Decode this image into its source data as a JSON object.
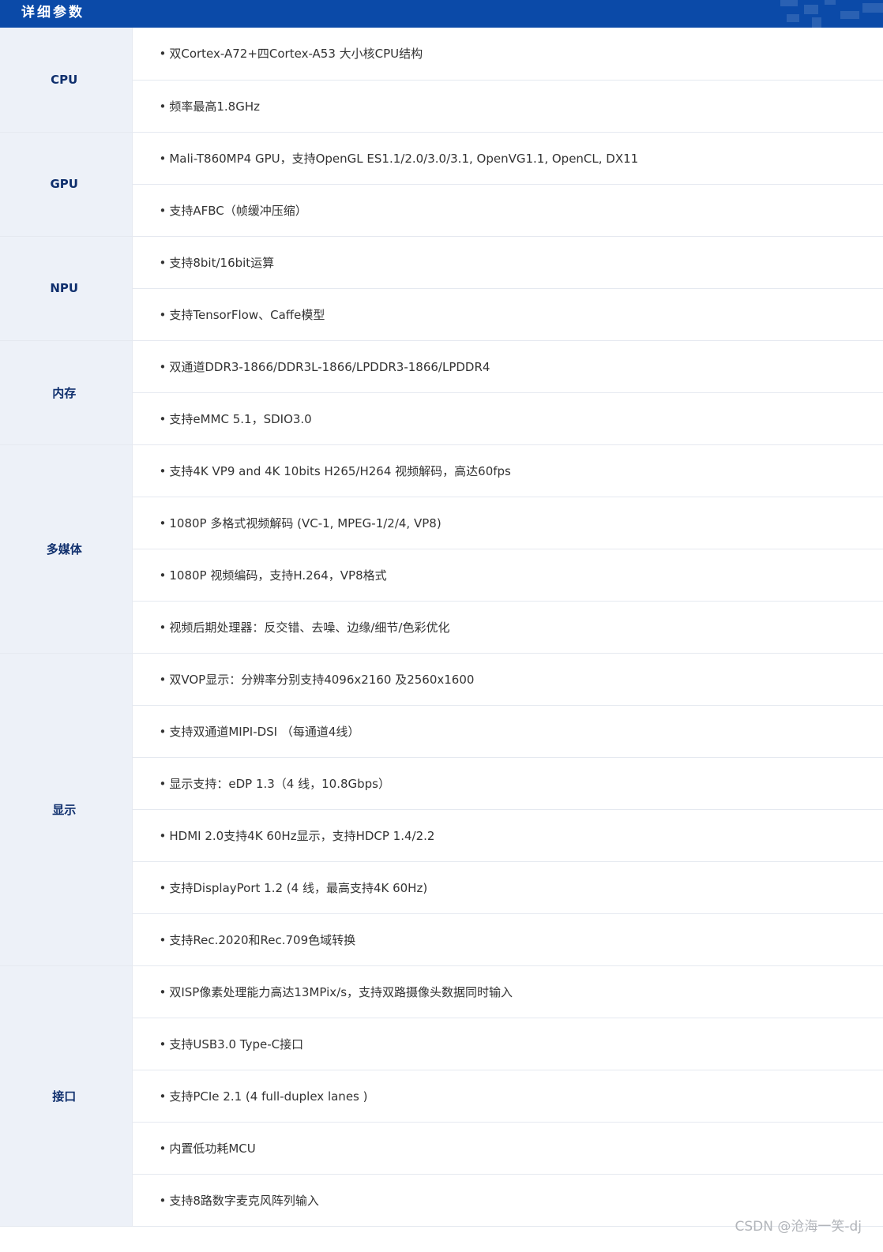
{
  "header": {
    "title": "详细参数"
  },
  "groups": [
    {
      "label": "CPU",
      "items": [
        "双Cortex-A72+四Cortex-A53 大小核CPU结构",
        "频率最高1.8GHz"
      ]
    },
    {
      "label": "GPU",
      "items": [
        "Mali-T860MP4 GPU，支持OpenGL ES1.1/2.0/3.0/3.1, OpenVG1.1, OpenCL, DX11",
        "支持AFBC（帧缓冲压缩）"
      ]
    },
    {
      "label": "NPU",
      "items": [
        "支持8bit/16bit运算",
        "支持TensorFlow、Caffe模型"
      ]
    },
    {
      "label": "内存",
      "items": [
        "双通道DDR3-1866/DDR3L-1866/LPDDR3-1866/LPDDR4",
        "支持eMMC 5.1，SDIO3.0"
      ]
    },
    {
      "label": "多媒体",
      "items": [
        "支持4K VP9 and 4K 10bits H265/H264 视频解码，高达60fps",
        "1080P 多格式视频解码 (VC-1, MPEG-1/2/4, VP8)",
        "1080P 视频编码，支持H.264，VP8格式",
        "视频后期处理器：反交错、去噪、边缘/细节/色彩优化"
      ]
    },
    {
      "label": "显示",
      "items": [
        "双VOP显示：分辨率分别支持4096x2160 及2560x1600",
        "支持双通道MIPI-DSI （每通道4线）",
        "显示支持：eDP 1.3（4 线，10.8Gbps）",
        "HDMI 2.0支持4K 60Hz显示，支持HDCP 1.4/2.2",
        "支持DisplayPort 1.2 (4 线，最高支持4K 60Hz)",
        "支持Rec.2020和Rec.709色域转换"
      ]
    },
    {
      "label": "接口",
      "items": [
        "双ISP像素处理能力高达13MPix/s，支持双路摄像头数据同时输入",
        "支持USB3.0 Type-C接口",
        "支持PCIe 2.1 (4 full-duplex lanes )",
        "内置低功耗MCU",
        "支持8路数字麦克风阵列输入"
      ]
    }
  ],
  "bullet": "•",
  "watermark": "CSDN @沧海一笑-dj",
  "colors": {
    "header_bg": "#0b4aa8",
    "label_bg": "#edf1f8",
    "label_text": "#0f2f6d",
    "value_text": "#333333",
    "divider": "#e5e9f0"
  }
}
